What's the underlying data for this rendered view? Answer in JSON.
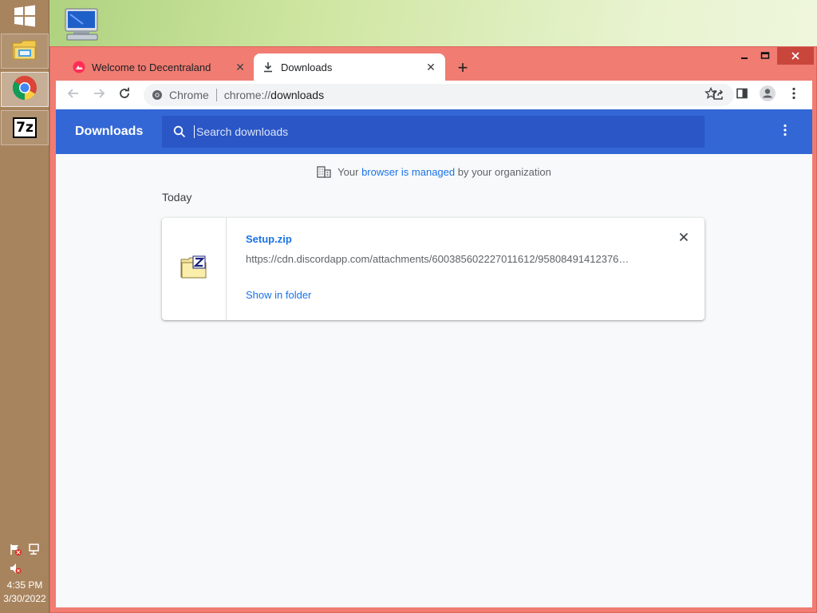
{
  "desktop": {
    "icon": "computer-icon"
  },
  "taskbar": {
    "start_icon": "windows-logo-icon",
    "items": [
      {
        "name": "file-explorer",
        "icon": "folder-icon"
      },
      {
        "name": "chrome",
        "icon": "chrome-icon"
      },
      {
        "name": "7zip",
        "icon": "7zip-icon",
        "label": "7z"
      }
    ],
    "tray": {
      "time": "4:35 PM",
      "date": "3/30/2022"
    }
  },
  "browser": {
    "tabs": [
      {
        "title": "Welcome to Decentraland",
        "icon": "decentraland-icon",
        "active": false
      },
      {
        "title": "Downloads",
        "icon": "download-icon",
        "active": true
      }
    ],
    "omnibox": {
      "site": "Chrome",
      "url_scheme": "chrome://",
      "url_host": "downloads"
    }
  },
  "downloads": {
    "title": "Downloads",
    "search_placeholder": "Search downloads",
    "managed_prefix": "Your ",
    "managed_link": "browser is managed",
    "managed_suffix": " by your organization",
    "section": "Today",
    "items": [
      {
        "filename": "Setup.zip",
        "url": "https://cdn.discordapp.com/attachments/600385602227011612/95808491412376…",
        "action": "Show in folder"
      }
    ]
  },
  "colors": {
    "header_blue": "#3367d6",
    "link_blue": "#1a73e8",
    "window_frame": "#f07c72",
    "taskbar": "#a8845e"
  }
}
